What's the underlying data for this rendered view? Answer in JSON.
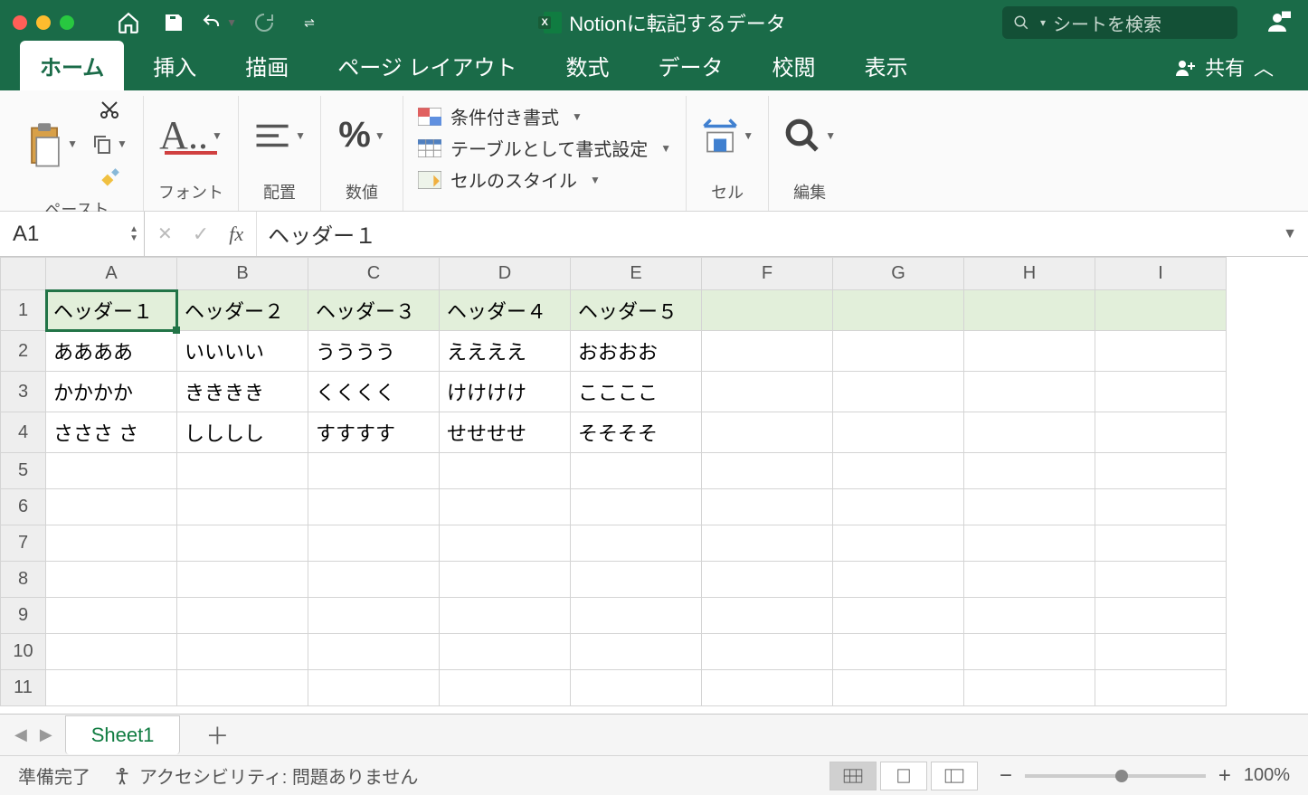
{
  "titlebar": {
    "doc_title": "Notionに転記するデータ",
    "search_placeholder": "シートを検索"
  },
  "tabs": {
    "home": "ホーム",
    "insert": "挿入",
    "draw": "描画",
    "layout": "ページ レイアウト",
    "formulas": "数式",
    "data": "データ",
    "review": "校閲",
    "view": "表示",
    "share": "共有"
  },
  "ribbon": {
    "paste": "ペースト",
    "font": "フォント",
    "align": "配置",
    "number": "数値",
    "cond_format": "条件付き書式",
    "table_format": "テーブルとして書式設定",
    "cell_styles": "セルのスタイル",
    "cells": "セル",
    "editing": "編集",
    "percent": "%"
  },
  "namebox": "A1",
  "formula": "ヘッダー１",
  "columns": [
    "A",
    "B",
    "C",
    "D",
    "E",
    "F",
    "G",
    "H",
    "I"
  ],
  "rows": [
    "1",
    "2",
    "3",
    "4",
    "5",
    "6",
    "7",
    "8",
    "9",
    "10",
    "11"
  ],
  "cells": {
    "r1": [
      "ヘッダー１",
      "ヘッダー２",
      "ヘッダー３",
      "ヘッダー４",
      "ヘッダー５",
      "",
      "",
      "",
      ""
    ],
    "r2": [
      "ああああ",
      "いいいい",
      "うううう",
      "ええええ",
      "おおおお",
      "",
      "",
      "",
      ""
    ],
    "r3": [
      "かかかか",
      "きききき",
      "くくくく",
      "けけけけ",
      "ここここ",
      "",
      "",
      "",
      ""
    ],
    "r4": [
      "さささ さ",
      "しししし",
      "すすすす",
      "せせせせ",
      "そそそそ",
      "",
      "",
      "",
      ""
    ],
    "r5": [
      "",
      "",
      "",
      "",
      "",
      "",
      "",
      "",
      ""
    ],
    "r6": [
      "",
      "",
      "",
      "",
      "",
      "",
      "",
      "",
      ""
    ],
    "r7": [
      "",
      "",
      "",
      "",
      "",
      "",
      "",
      "",
      ""
    ],
    "r8": [
      "",
      "",
      "",
      "",
      "",
      "",
      "",
      "",
      ""
    ],
    "r9": [
      "",
      "",
      "",
      "",
      "",
      "",
      "",
      "",
      ""
    ],
    "r10": [
      "",
      "",
      "",
      "",
      "",
      "",
      "",
      "",
      ""
    ],
    "r11": [
      "",
      "",
      "",
      "",
      "",
      "",
      "",
      "",
      ""
    ]
  },
  "sheet_tab": "Sheet1",
  "status": {
    "ready": "準備完了",
    "a11y": "アクセシビリティ: 問題ありません",
    "zoom": "100%"
  }
}
